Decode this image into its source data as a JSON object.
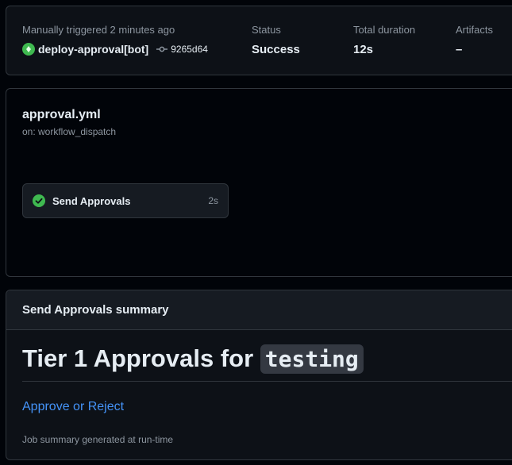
{
  "run": {
    "trigger_text": "Manually triggered 2 minutes ago",
    "actor": "deploy-approval[bot]",
    "commit_sha": "9265d64",
    "status_label": "Status",
    "status_value": "Success",
    "duration_label": "Total duration",
    "duration_value": "12s",
    "artifacts_label": "Artifacts",
    "artifacts_value": "–"
  },
  "workflow": {
    "file_name": "approval.yml",
    "trigger": "on: workflow_dispatch",
    "jobs": [
      {
        "name": "Send Approvals",
        "duration": "2s",
        "status": "success",
        "status_icon": "check-circle-fill-icon"
      }
    ]
  },
  "summary": {
    "header": "Send Approvals summary",
    "heading_text": "Tier 1 Approvals for ",
    "heading_code": "testing",
    "link_text": "Approve or Reject",
    "footnote": "Job summary generated at run-time"
  },
  "colors": {
    "success": "#3fb950",
    "link": "#4493f8",
    "background": "#010409",
    "card": "#0d1117",
    "border": "#30363d"
  }
}
